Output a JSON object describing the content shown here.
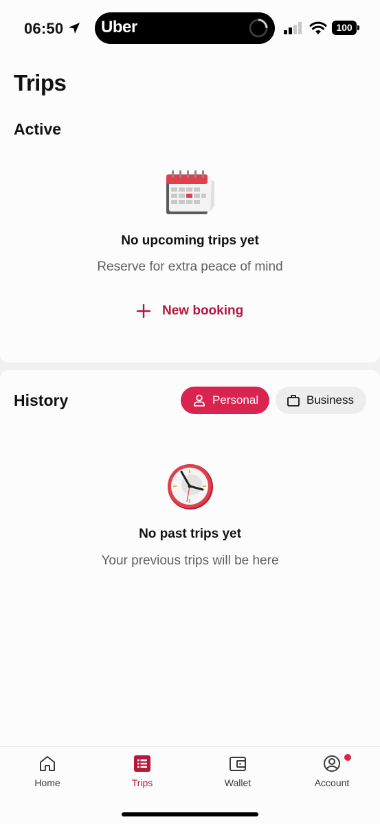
{
  "status_bar": {
    "time": "06:50",
    "island_app": "Uber",
    "battery": "100"
  },
  "page": {
    "title": "Trips"
  },
  "active": {
    "heading": "Active",
    "empty_title": "No upcoming trips yet",
    "empty_subtitle": "Reserve for extra peace of mind",
    "new_booking_label": "New booking"
  },
  "history": {
    "heading": "History",
    "filters": [
      {
        "label": "Personal",
        "selected": true
      },
      {
        "label": "Business",
        "selected": false
      }
    ],
    "empty_title": "No past trips yet",
    "empty_subtitle": "Your previous trips will be here"
  },
  "bottom_nav": {
    "items": [
      {
        "label": "Home",
        "icon": "home-icon",
        "active": false
      },
      {
        "label": "Trips",
        "icon": "trips-list-icon",
        "active": true
      },
      {
        "label": "Wallet",
        "icon": "wallet-icon",
        "active": false
      },
      {
        "label": "Account",
        "icon": "account-icon",
        "active": false,
        "has_notification": true
      }
    ]
  },
  "colors": {
    "accent": "#d8244f",
    "accent_text": "#b5183e",
    "background": "#fcfcfc",
    "chip_inactive": "#ededed"
  }
}
